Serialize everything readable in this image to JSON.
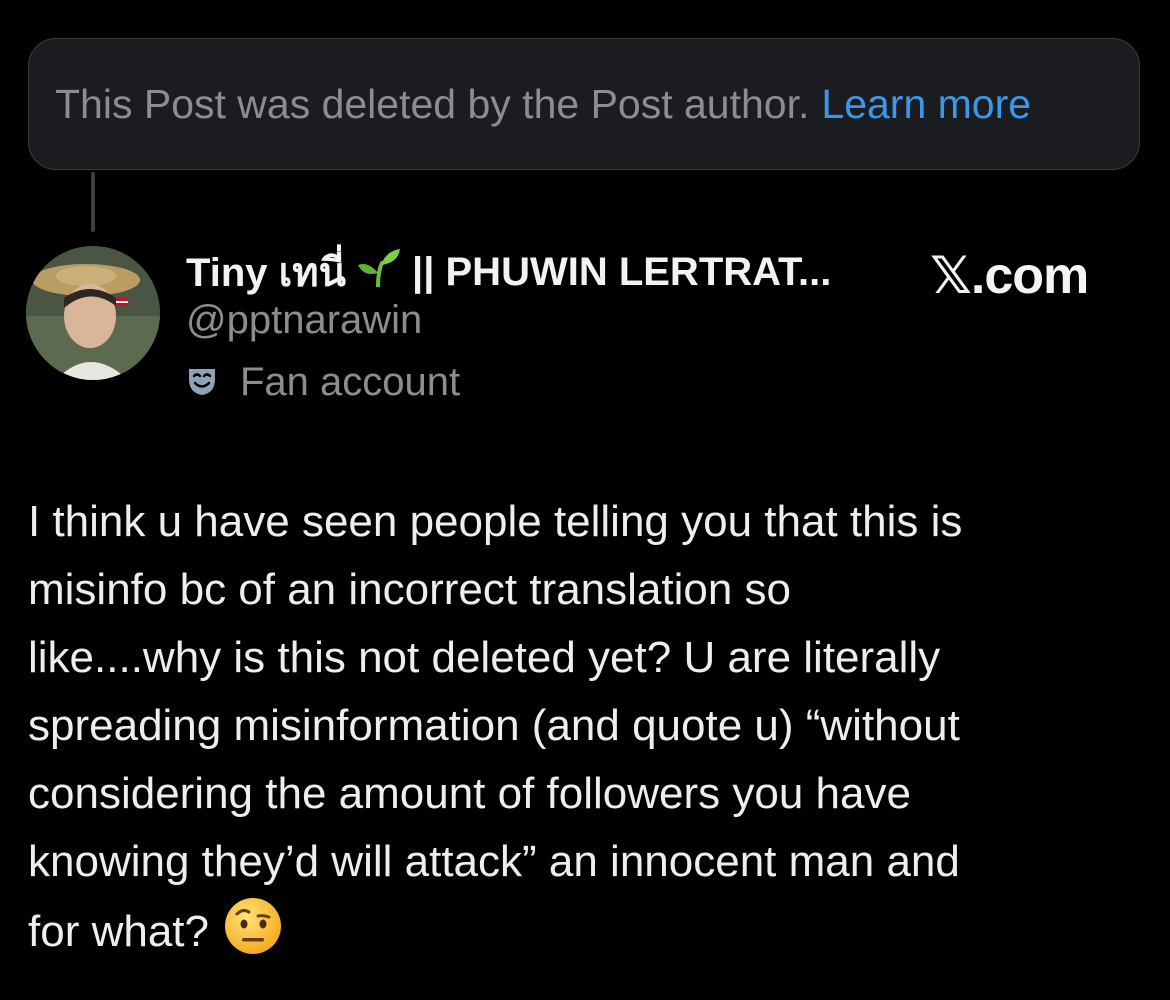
{
  "deleted_notice": {
    "text": "This Post was deleted by the Post author.",
    "link": "Learn more"
  },
  "author": {
    "name_start": "Tiny เทนี่",
    "name_end": "|| PHUWIN LERTRAT...",
    "handle": "@pptnarawin",
    "label": "Fan account"
  },
  "brand": "𝕏.com",
  "tweet": {
    "lines": [
      "I think u have seen people telling you that this is",
      "misinfo bc of an incorrect translation so",
      "like....why is this not deleted yet? U are literally",
      "spreading misinformation (and quote u) “without",
      "considering the amount of followers you have",
      "knowing they’d will attack” an innocent man and",
      "for what?"
    ]
  },
  "colors": {
    "background": "#000000",
    "link": "#3b97ea",
    "muted": "#8b8d91",
    "text": "#eeeeee"
  },
  "icons": {
    "sprout": "seedling-icon",
    "label": "mask-icon",
    "end_emoji": "raised-eyebrow-face-icon"
  }
}
